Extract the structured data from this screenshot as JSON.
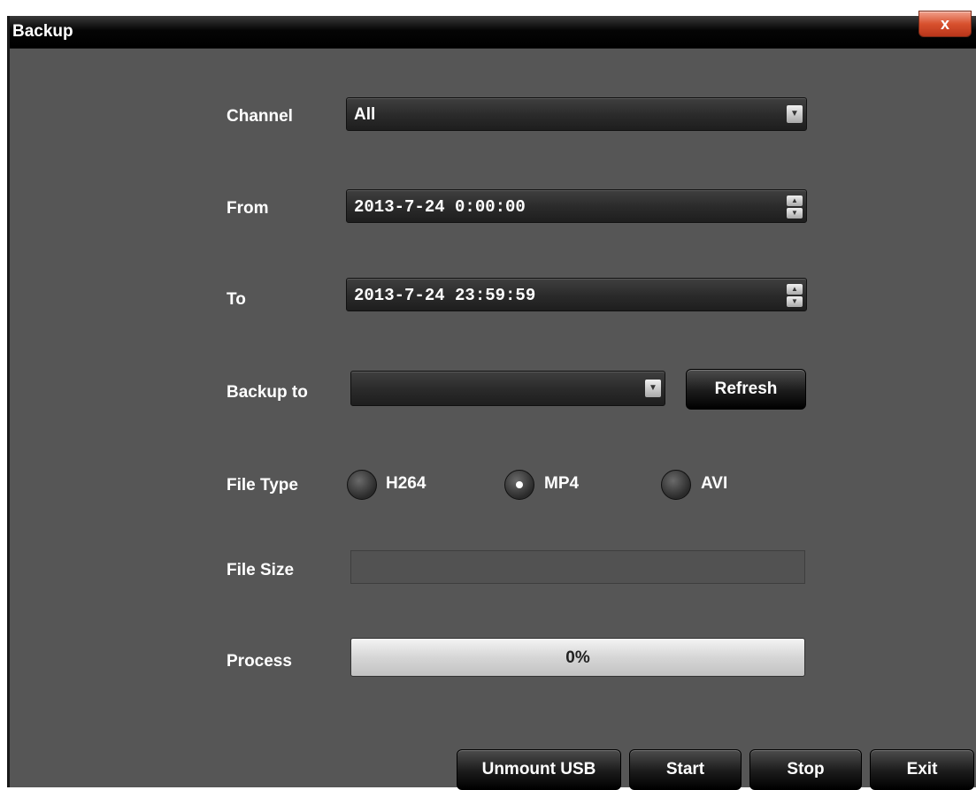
{
  "window": {
    "title": "Backup",
    "close": "x"
  },
  "form": {
    "channel": {
      "label": "Channel",
      "value": "All"
    },
    "from": {
      "label": "From",
      "value": "2013-7-24 0:00:00"
    },
    "to": {
      "label": "To",
      "value": "2013-7-24 23:59:59"
    },
    "backup_to": {
      "label": "Backup to",
      "value": "",
      "refresh": "Refresh"
    },
    "file_type": {
      "label": "File Type",
      "options": [
        "H264",
        "MP4",
        "AVI"
      ],
      "selected": "MP4"
    },
    "file_size": {
      "label": "File Size",
      "value": ""
    },
    "process": {
      "label": "Process",
      "text": "0%",
      "value": 0
    }
  },
  "buttons": {
    "unmount": "Unmount USB",
    "start": "Start",
    "stop": "Stop",
    "exit": "Exit"
  },
  "icons": {
    "close": "close-icon",
    "dropdown": "chevron-down-icon",
    "spinner": "spinner-arrows-icon"
  }
}
